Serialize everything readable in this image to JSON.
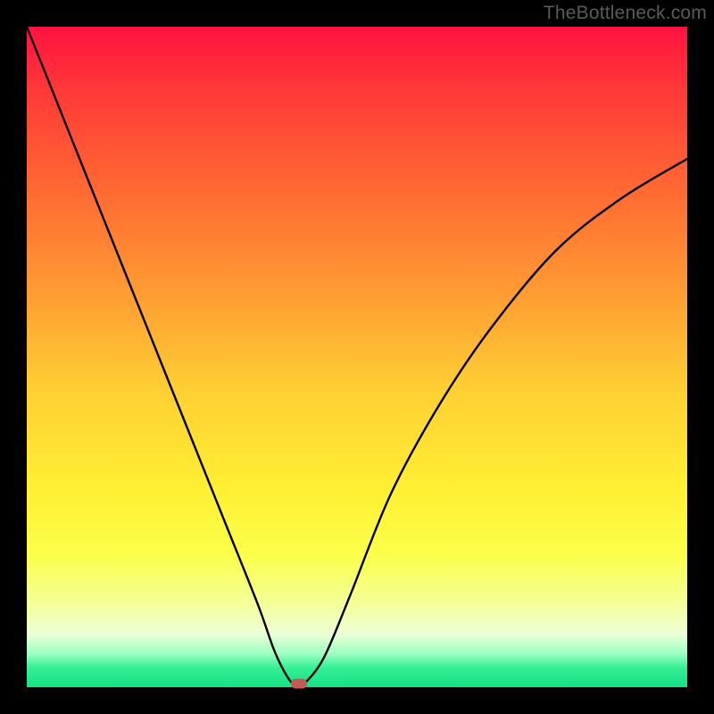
{
  "watermark": "TheBottleneck.com",
  "chart_data": {
    "type": "line",
    "title": "",
    "xlabel": "",
    "ylabel": "",
    "xlim": [
      0,
      1
    ],
    "ylim": [
      0,
      1
    ],
    "series": [
      {
        "name": "curve",
        "x": [
          0.0,
          0.05,
          0.1,
          0.15,
          0.2,
          0.25,
          0.3,
          0.35,
          0.375,
          0.395,
          0.41,
          0.42,
          0.45,
          0.49,
          0.55,
          0.62,
          0.7,
          0.8,
          0.9,
          1.0
        ],
        "y": [
          1.0,
          0.875,
          0.75,
          0.625,
          0.5,
          0.375,
          0.25,
          0.125,
          0.055,
          0.015,
          0.0,
          0.005,
          0.045,
          0.14,
          0.29,
          0.42,
          0.54,
          0.66,
          0.74,
          0.8
        ]
      }
    ],
    "marker": {
      "x": 0.412,
      "y": 0.005
    },
    "gradient_colors": {
      "top": "#ff1240",
      "mid_high": "#ff9b33",
      "mid": "#ffef33",
      "mid_low": "#f3ffa0",
      "bottom": "#16e085"
    }
  }
}
